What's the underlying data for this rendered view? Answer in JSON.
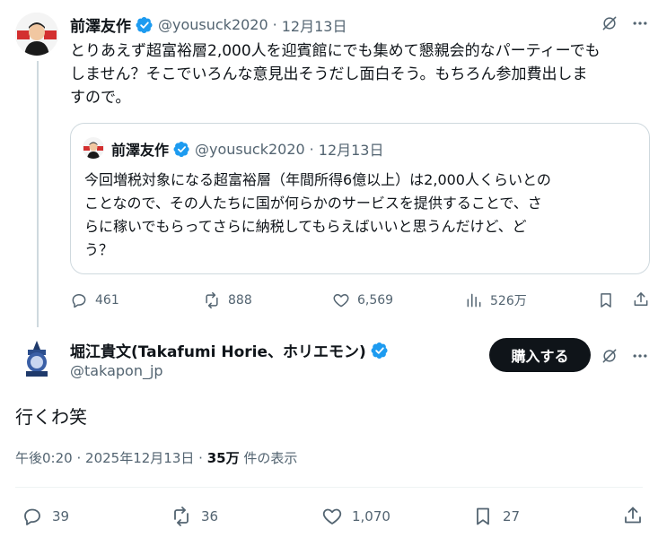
{
  "parent": {
    "name": "前澤友作",
    "handle": "@yousuck2020",
    "sep": "·",
    "date": "12月13日",
    "text_lines": [
      "とりあえず超富裕層2,000人を迎賓館にでも集めて懇親会的なパーティーでも",
      "しません？そこでいろんな意見出そうだし面白そう。もちろん参加費出しま",
      "すので。"
    ],
    "quote": {
      "name": "前澤友作",
      "handle": "@yousuck2020",
      "sep": "·",
      "date": "12月13日",
      "text_lines": [
        "今回増税対象になる超富裕層（年間所得6億以上）は2,000人くらいとの",
        "ことなので、その人たちに国が何らかのサービスを提供することで、さ",
        "らに稼いでもらってさらに納税してもらえばいいと思うんだけど、ど",
        "う？"
      ]
    },
    "actions": {
      "replies": "461",
      "reposts": "888",
      "likes": "6,569",
      "views": "526万"
    }
  },
  "main": {
    "name": "堀江貴文(Takafumi Horie、ホリエモン)",
    "handle": "@takapon_jp",
    "buy_label": "購入する",
    "text": "行くわ笑",
    "time": "午後0:20",
    "sep": "·",
    "date": "2025年12月13日",
    "views_count": "35万",
    "views_label": "件の表示",
    "actions": {
      "replies": "39",
      "reposts": "36",
      "likes": "1,070",
      "bookmarks": "27"
    }
  },
  "icons": {
    "verified": "verified-badge-icon",
    "grok": "grok-icon",
    "more": "more-dots-icon",
    "reply": "reply-icon",
    "repost": "repost-icon",
    "like": "heart-icon",
    "views": "views-chart-icon",
    "bookmark": "bookmark-icon",
    "share": "share-icon"
  },
  "colors": {
    "verified_blue": "#1d9bf0",
    "text": "#0f1419",
    "secondary": "#536471",
    "border": "#cfd9de"
  }
}
